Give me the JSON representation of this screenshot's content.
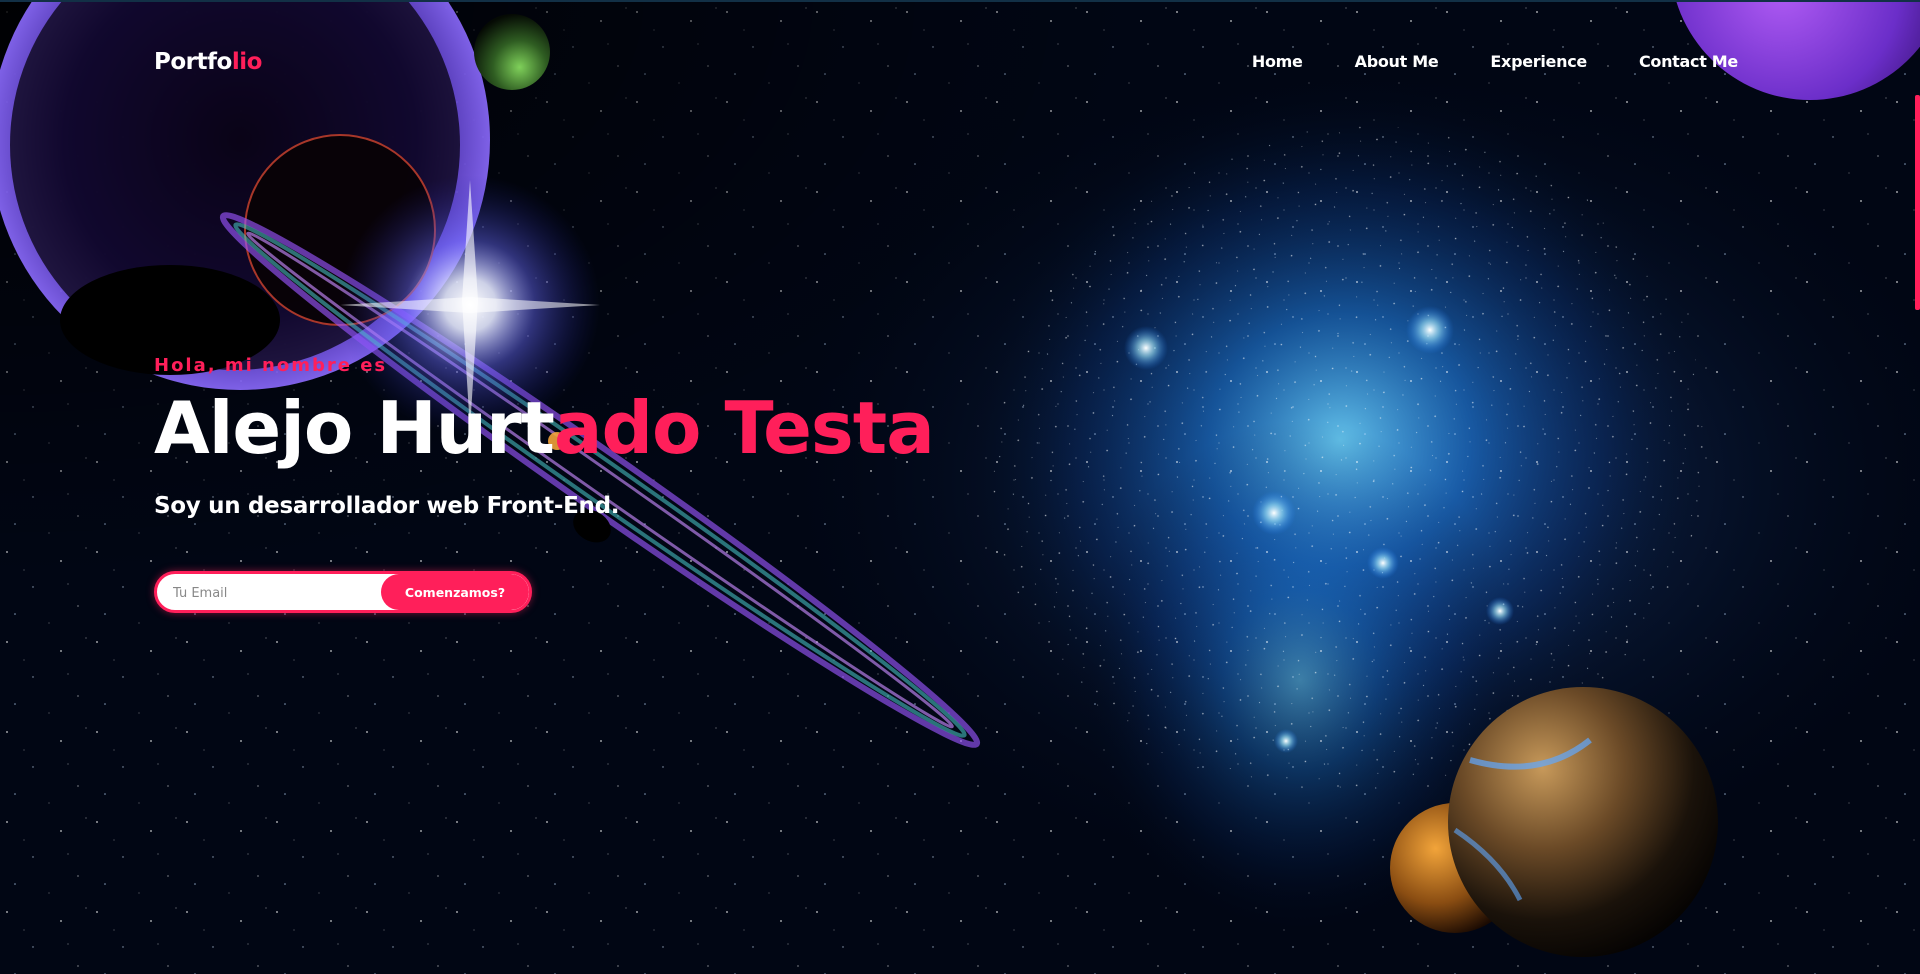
{
  "nav": {
    "logo_main": "Portfo",
    "logo_accent": "lio",
    "links": [
      "Home",
      "About Me",
      "Experience",
      "Contact Me"
    ]
  },
  "hero": {
    "greeting": "Hola, mi nombre es",
    "name_white": "Alejo Hurt",
    "name_accent": "ado Testa",
    "tagline": "Soy un desarrollador web Front-End.",
    "email_placeholder": "Tu Email",
    "email_value": "",
    "cta_label": "Comenzamos?"
  },
  "colors": {
    "accent": "#ff1f5a",
    "background": "#010614",
    "text": "#ffffff"
  }
}
